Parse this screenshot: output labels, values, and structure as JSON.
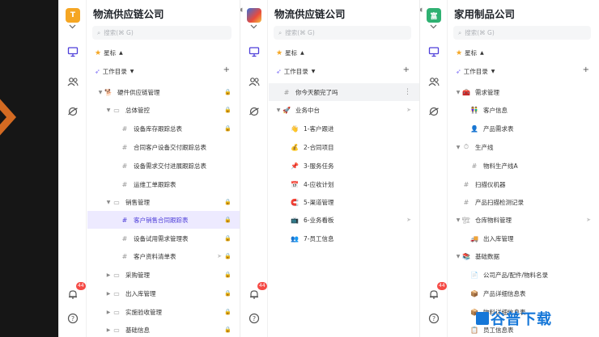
{
  "search_placeholder": "搜索(⌘ G)",
  "starred_label": "星标",
  "workspace_label": "工作目录",
  "notification_count": "44",
  "colors": {
    "accent": "#4e3fd9",
    "selected_bg": "#edeaff",
    "bg_dark": "#161616",
    "orange": "#d36a22"
  },
  "panel1": {
    "title": "物流供应链公司",
    "avatar_letter": "T",
    "tree": [
      {
        "label": "硬件供应链管理"
      },
      {
        "label": "总体管控"
      },
      {
        "label": "设备库存跟踪总表"
      },
      {
        "label": "合同客户设备交付跟踪总表"
      },
      {
        "label": "设备需求交付进展跟踪总表"
      },
      {
        "label": "运维工单跟踪表"
      },
      {
        "label": "销售管理"
      },
      {
        "label": "客户销售合同跟踪表"
      },
      {
        "label": "设备试用需求管理表"
      },
      {
        "label": "客户资料清单表"
      },
      {
        "label": "采购管理"
      },
      {
        "label": "出入库管理"
      },
      {
        "label": "实施验收管理"
      },
      {
        "label": "基础信息"
      }
    ]
  },
  "panel2": {
    "title": "物流供应链公司",
    "tree": [
      {
        "label": "你今天额完了吗"
      },
      {
        "label": "业务中台"
      },
      {
        "label": "1-客户跟进"
      },
      {
        "label": "2-合同项目"
      },
      {
        "label": "3-服务任务"
      },
      {
        "label": "4-应收计划"
      },
      {
        "label": "5-渠道管理"
      },
      {
        "label": "6-业务看板"
      },
      {
        "label": "7-员工信息"
      }
    ]
  },
  "panel3": {
    "title": "家用制品公司",
    "avatar_letter": "富",
    "tree": [
      {
        "label": "需求管理"
      },
      {
        "label": "客户信息"
      },
      {
        "label": "产品需求表"
      },
      {
        "label": "生产线"
      },
      {
        "label": "物料生产线A"
      },
      {
        "label": "扫描仪机器"
      },
      {
        "label": "产品扫描检测记录"
      },
      {
        "label": "仓库物料管理"
      },
      {
        "label": "出入库管理"
      },
      {
        "label": "基础数据"
      },
      {
        "label": "公司产品/配件/物料名录"
      },
      {
        "label": "产品详细信息表"
      },
      {
        "label": "物料详细信息表"
      },
      {
        "label": "员工信息表"
      }
    ]
  },
  "watermark": "谷普下载"
}
